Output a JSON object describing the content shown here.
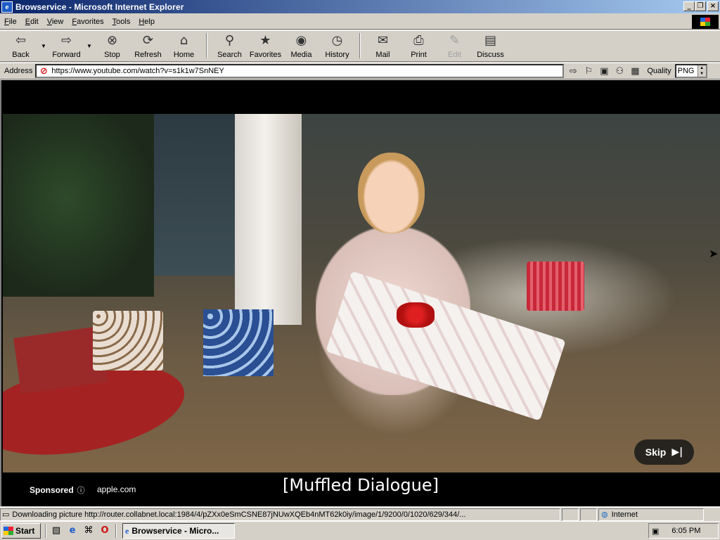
{
  "window": {
    "title": "Browservice - Microsoft Internet Explorer"
  },
  "menu": [
    "File",
    "Edit",
    "View",
    "Favorites",
    "Tools",
    "Help"
  ],
  "toolbar": {
    "buttons": [
      {
        "label": "Back",
        "icon": "back-arrow-icon"
      },
      {
        "label": "Forward",
        "icon": "forward-arrow-icon"
      },
      {
        "label": "Stop",
        "icon": "stop-icon"
      },
      {
        "label": "Refresh",
        "icon": "refresh-icon"
      },
      {
        "label": "Home",
        "icon": "home-icon"
      },
      {
        "label": "Search",
        "icon": "search-icon"
      },
      {
        "label": "Favorites",
        "icon": "favorites-icon"
      },
      {
        "label": "Media",
        "icon": "media-icon"
      },
      {
        "label": "History",
        "icon": "history-icon"
      },
      {
        "label": "Mail",
        "icon": "mail-icon"
      },
      {
        "label": "Print",
        "icon": "print-icon"
      },
      {
        "label": "Edit",
        "icon": "edit-icon"
      },
      {
        "label": "Discuss",
        "icon": "discuss-icon"
      }
    ]
  },
  "address": {
    "label": "Address",
    "url": "https://www.youtube.com/watch?v=s1k1w7SnNEY",
    "quality_label": "Quality",
    "quality_value": "PNG"
  },
  "video": {
    "skip_label": "Skip",
    "sponsored_label": "Sponsored",
    "advertiser": "apple.com",
    "caption": "[Muffled Dialogue]"
  },
  "status": {
    "text": "Downloading picture http://router.collabnet.local:1984/4/pZXx0eSmCSNE87jNUwXQEb4nMT62k0iy/image/1/9200/0/1020/629/344/...",
    "zone": "Internet"
  },
  "taskbar": {
    "start_label": "Start",
    "task_label": "Browservice - Micro...",
    "clock": "6:05 PM"
  }
}
